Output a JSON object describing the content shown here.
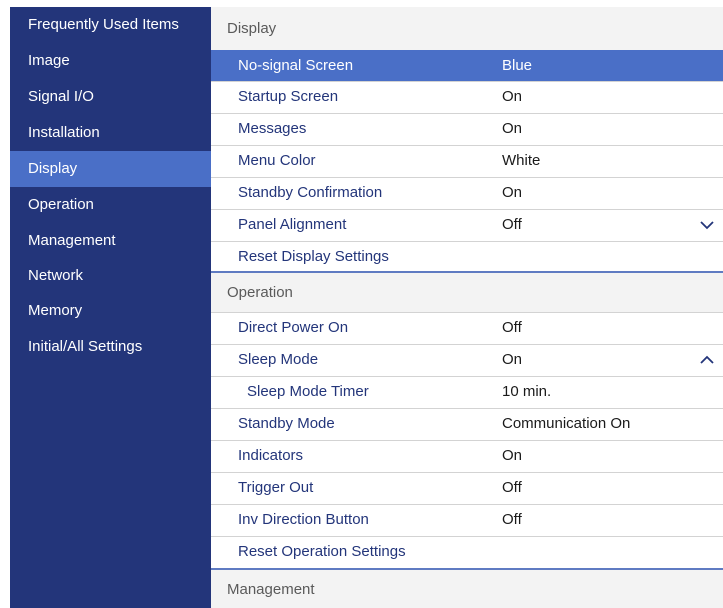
{
  "sidebar": {
    "items": [
      {
        "label": "Frequently Used Items"
      },
      {
        "label": "Image"
      },
      {
        "label": "Signal I/O"
      },
      {
        "label": "Installation"
      },
      {
        "label": "Display"
      },
      {
        "label": "Operation"
      },
      {
        "label": "Management"
      },
      {
        "label": "Network"
      },
      {
        "label": "Memory"
      },
      {
        "label": "Initial/All Settings"
      }
    ],
    "selected": "Display"
  },
  "main": {
    "display": {
      "header": "Display",
      "rows": [
        {
          "label": "No-signal Screen",
          "value": "Blue"
        },
        {
          "label": "Startup Screen",
          "value": "On"
        },
        {
          "label": "Messages",
          "value": "On"
        },
        {
          "label": "Menu Color",
          "value": "White"
        },
        {
          "label": "Standby Confirmation",
          "value": "On"
        },
        {
          "label": "Panel Alignment",
          "value": "Off",
          "icon": "chevron-down-icon"
        },
        {
          "label": "Reset Display Settings",
          "value": ""
        }
      ]
    },
    "operation": {
      "header": "Operation",
      "rows": [
        {
          "label": "Direct Power On",
          "value": "Off"
        },
        {
          "label": "Sleep Mode",
          "value": "On",
          "icon": "chevron-up-icon"
        },
        {
          "label": "Sleep Mode Timer",
          "value": "10 min."
        },
        {
          "label": "Standby Mode",
          "value": "Communication On"
        },
        {
          "label": "Indicators",
          "value": "On"
        },
        {
          "label": "Trigger Out",
          "value": "Off"
        },
        {
          "label": "Inv Direction Button",
          "value": "Off"
        },
        {
          "label": "Reset Operation Settings",
          "value": ""
        }
      ]
    },
    "management": {
      "header": "Management"
    }
  },
  "colors": {
    "sidebar_bg": "#23357a",
    "selected_bg": "#4a6fc7",
    "row_label": "#23357a",
    "panel_bg": "#f3f3f3"
  }
}
